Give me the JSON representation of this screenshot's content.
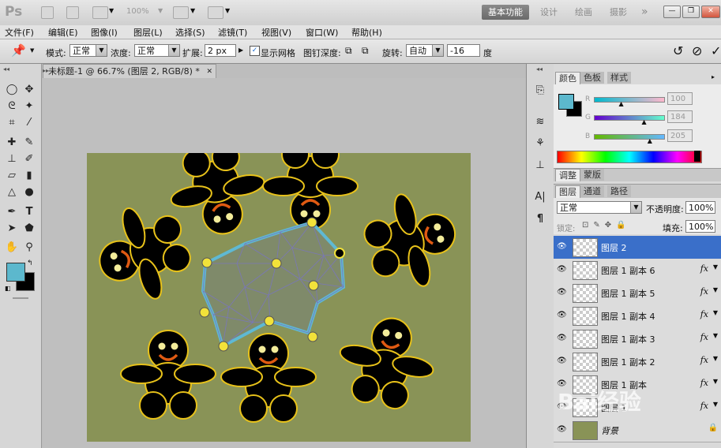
{
  "app": {
    "logo": "Ps",
    "zoom": "100%"
  },
  "workspaces": {
    "basic": "基本功能",
    "design": "设计",
    "painting": "绘画",
    "photography": "摄影",
    "more": "»"
  },
  "window_controls": {
    "minimize": "—",
    "restore": "❐",
    "close": "✕"
  },
  "menu": [
    "文件(F)",
    "编辑(E)",
    "图像(I)",
    "图层(L)",
    "选择(S)",
    "滤镜(T)",
    "视图(V)",
    "窗口(W)",
    "帮助(H)"
  ],
  "options": {
    "mode_label": "模式:",
    "mode_value": "正常",
    "density_label": "浓度:",
    "density_value": "正常",
    "expand_label": "扩展:",
    "expand_value": "2 px",
    "show_mesh_label": "显示网格",
    "pin_depth_label": "图钉深度:",
    "rotate_label": "旋转:",
    "rotate_value": "自动",
    "rotate_angle": "-16",
    "degree_label": "度"
  },
  "document": {
    "tab_title": "未标题-1 @ 66.7% (图层 2, RGB/8) *",
    "close": "✕"
  },
  "color_panel": {
    "tabs": [
      "颜色",
      "色板",
      "样式"
    ],
    "r_label": "R",
    "g_label": "G",
    "b_label": "B",
    "r_value": 100,
    "g_value": 184,
    "b_value": 205,
    "foreground": "#5cb8cd",
    "background": "#000000"
  },
  "adjust_tabs": [
    "调整",
    "蒙版"
  ],
  "layers_panel": {
    "tabs": [
      "图层",
      "通道",
      "路径"
    ],
    "blend_mode": "正常",
    "opacity_label": "不透明度:",
    "opacity_value": "100%",
    "lock_label": "锁定:",
    "fill_label": "填充:",
    "fill_value": "100%",
    "layers": [
      {
        "name": "图层 2",
        "selected": true,
        "fx": ""
      },
      {
        "name": "图层 1 副本 6",
        "selected": false,
        "fx": "fx"
      },
      {
        "name": "图层 1 副本 5",
        "selected": false,
        "fx": "fx"
      },
      {
        "name": "图层 1 副本 4",
        "selected": false,
        "fx": "fx"
      },
      {
        "name": "图层 1 副本 3",
        "selected": false,
        "fx": "fx"
      },
      {
        "name": "图层 1 副本 2",
        "selected": false,
        "fx": "fx"
      },
      {
        "name": "图层 1 副本",
        "selected": false,
        "fx": "fx"
      },
      {
        "name": "图层 1",
        "selected": false,
        "fx": "fx"
      },
      {
        "name": "背景",
        "selected": false,
        "fx": ""
      }
    ]
  },
  "watermark": "Bai经验",
  "colors": {
    "canvas": "#899357",
    "figure": "#000000",
    "outline": "#e8c21a",
    "smile": "#e05a12",
    "mesh": "#5fb9d3",
    "selection": "#3a6fc9"
  }
}
